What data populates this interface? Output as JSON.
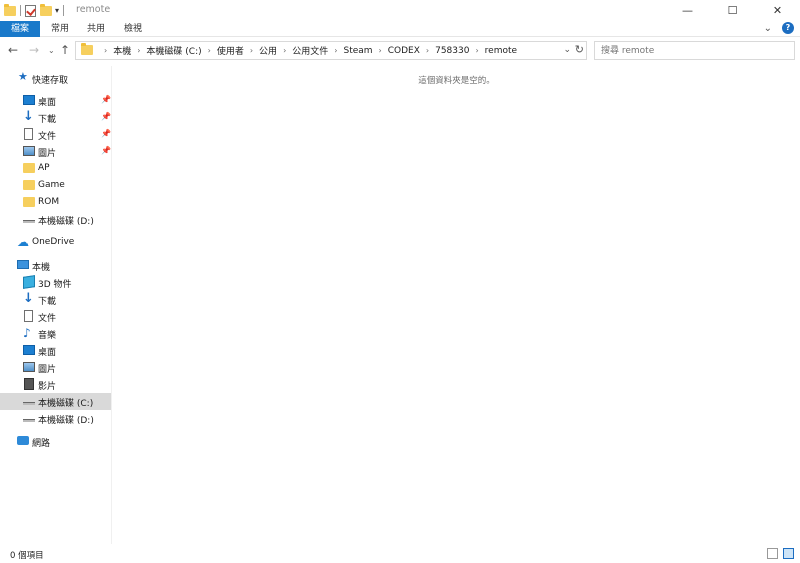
{
  "window": {
    "title": "remote",
    "controls": {
      "minimize": "—",
      "maximize": "☐",
      "close": "✕"
    }
  },
  "ribbon": {
    "tabs": [
      "檔案",
      "常用",
      "共用",
      "檢視"
    ],
    "expand_glyph": "⌄",
    "help_glyph": "?"
  },
  "nav": {
    "back_glyph": "←",
    "forward_glyph": "→",
    "recent_glyph": "⌄",
    "up_glyph": "↑"
  },
  "address": {
    "crumbs": [
      "本機",
      "本機磁碟 (C:)",
      "使用者",
      "公用",
      "公用文件",
      "Steam",
      "CODEX",
      "758330",
      "remote"
    ],
    "separator": "›",
    "dropdown_glyph": "⌄",
    "refresh_glyph": "↻"
  },
  "search": {
    "placeholder": "搜尋 remote"
  },
  "sidebar": {
    "items": [
      {
        "label": "快速存取",
        "icon": "star-icon"
      },
      {
        "label": "桌面",
        "icon": "desktop-icon",
        "pinned": true
      },
      {
        "label": "下載",
        "icon": "download-icon",
        "pinned": true
      },
      {
        "label": "文件",
        "icon": "document-icon",
        "pinned": true
      },
      {
        "label": "圖片",
        "icon": "pictures-icon",
        "pinned": true
      },
      {
        "label": "AP",
        "icon": "folder-icon"
      },
      {
        "label": "Game",
        "icon": "folder-icon"
      },
      {
        "label": "ROM",
        "icon": "folder-icon"
      },
      {
        "label": "本機磁碟 (D:)",
        "icon": "drive-icon"
      },
      {
        "label": "OneDrive",
        "icon": "cloud-icon"
      },
      {
        "label": "本機",
        "icon": "computer-icon"
      },
      {
        "label": "3D 物件",
        "icon": "3d-objects-icon"
      },
      {
        "label": "下載",
        "icon": "download-icon"
      },
      {
        "label": "文件",
        "icon": "document-icon"
      },
      {
        "label": "音樂",
        "icon": "music-icon"
      },
      {
        "label": "桌面",
        "icon": "desktop-icon"
      },
      {
        "label": "圖片",
        "icon": "pictures-icon"
      },
      {
        "label": "影片",
        "icon": "video-icon"
      },
      {
        "label": "本機磁碟 (C:)",
        "icon": "drive-icon",
        "selected": true
      },
      {
        "label": "本機磁碟 (D:)",
        "icon": "drive-icon"
      },
      {
        "label": "網路",
        "icon": "network-icon"
      }
    ]
  },
  "content": {
    "empty_message": "這個資料夾是空的。"
  },
  "status": {
    "item_count": "0 個項目"
  },
  "colors": {
    "accent": "#1979ca",
    "selected_bg": "#d9d9d9"
  }
}
